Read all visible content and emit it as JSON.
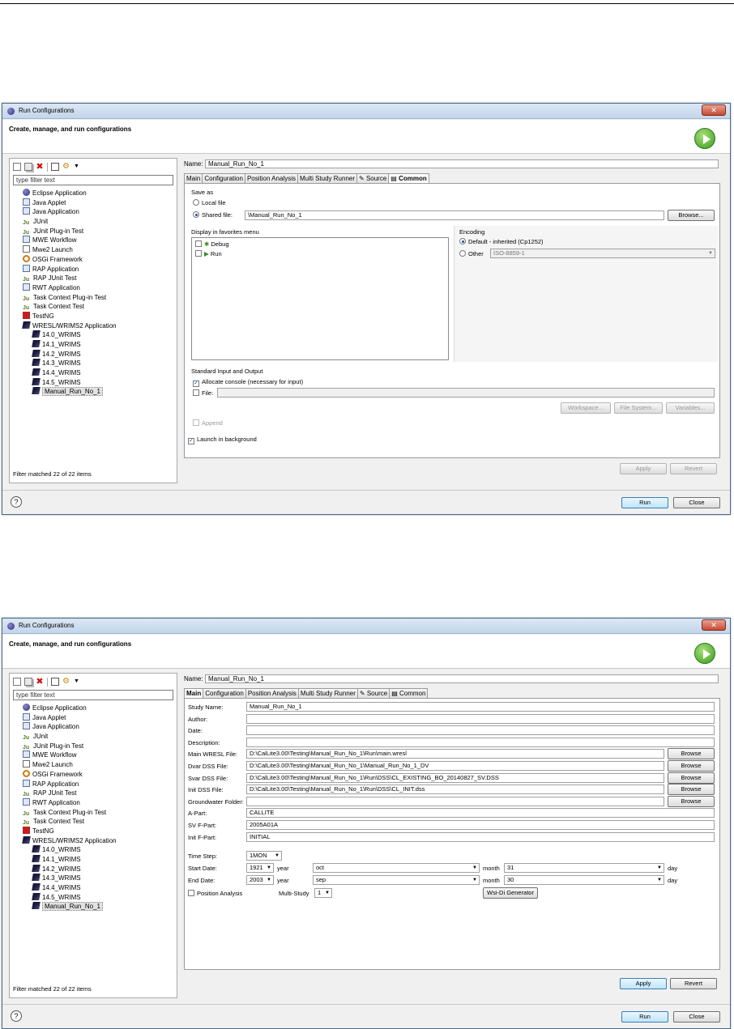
{
  "dialog1": {
    "title": "Run Configurations",
    "header": "Create, manage, and run configurations",
    "toolbar_icons": [
      "new-config-icon",
      "duplicate-icon",
      "delete-icon",
      "collapse-all-icon",
      "filter-icon",
      "dropdown-icon"
    ],
    "filter_placeholder": "type filter text",
    "tree": [
      {
        "label": "Eclipse Application",
        "icon": "circle",
        "level": 1
      },
      {
        "label": "Java Applet",
        "icon": "box",
        "level": 1
      },
      {
        "label": "Java Application",
        "icon": "box",
        "level": 1
      },
      {
        "label": "JUnit",
        "icon": "ju",
        "level": 1
      },
      {
        "label": "JUnit Plug-in Test",
        "icon": "ju",
        "level": 1
      },
      {
        "label": "MWE Workflow",
        "icon": "box",
        "level": 1
      },
      {
        "label": "Mwe2 Launch",
        "icon": "doc",
        "level": 1
      },
      {
        "label": "OSGi Framework",
        "icon": "gear",
        "level": 1
      },
      {
        "label": "RAP Application",
        "icon": "box",
        "level": 1
      },
      {
        "label": "RAP JUnit Test",
        "icon": "ju",
        "level": 1
      },
      {
        "label": "RWT Application",
        "icon": "box",
        "level": 1
      },
      {
        "label": "Task Context Plug-in Test",
        "icon": "ju",
        "level": 1
      },
      {
        "label": "Task Context Test",
        "icon": "ju",
        "level": 1
      },
      {
        "label": "TestNG",
        "icon": "ng",
        "level": 1
      },
      {
        "label": "WRESL/WRIMS2 Application",
        "icon": "w",
        "level": 1
      },
      {
        "label": "14.0_WRIMS",
        "icon": "w",
        "level": 2
      },
      {
        "label": "14.1_WRIMS",
        "icon": "w",
        "level": 2
      },
      {
        "label": "14.2_WRIMS",
        "icon": "w",
        "level": 2
      },
      {
        "label": "14.3_WRIMS",
        "icon": "w",
        "level": 2
      },
      {
        "label": "14.4_WRIMS",
        "icon": "w",
        "level": 2
      },
      {
        "label": "14.5_WRIMS",
        "icon": "w",
        "level": 2
      },
      {
        "label": "Manual_Run_No_1",
        "icon": "w",
        "level": 2,
        "selected": true
      }
    ],
    "filter_status": "Filter matched 22 of 22 items",
    "name_label": "Name:",
    "name_value": "Manual_Run_No_1",
    "tabs": [
      "Main",
      "Configuration",
      "Position Analysis",
      "Multi Study Runner",
      "Source",
      "Common"
    ],
    "active_tab": "Common",
    "save_as": {
      "title": "Save as",
      "local_file": "Local file",
      "shared_file": "Shared file:",
      "shared_value": "\\Manual_Run_No_1",
      "browse": "Browse..."
    },
    "favorites": {
      "title": "Display in favorites menu",
      "debug": "Debug",
      "run": "Run"
    },
    "encoding": {
      "title": "Encoding",
      "default": "Default - inherited (Cp1252)",
      "other": "Other",
      "other_value": "ISO-8859-1"
    },
    "std_io": {
      "title": "Standard Input and Output",
      "allocate": "Allocate console (necessary for input)",
      "file": "File:",
      "workspace": "Workspace...",
      "file_system": "File System...",
      "variables": "Variables...",
      "append": "Append"
    },
    "launch_bg": "Launch in background",
    "apply": "Apply",
    "revert": "Revert",
    "run": "Run",
    "close": "Close"
  },
  "dialog2": {
    "title": "Run Configurations",
    "header": "Create, manage, and run configurations",
    "filter_placeholder": "type filter text",
    "filter_status": "Filter matched 22 of 22 items",
    "name_label": "Name:",
    "name_value": "Manual_Run_No_1",
    "tabs": [
      "Main",
      "Configuration",
      "Position Analysis",
      "Multi Study Runner",
      "Source",
      "Common"
    ],
    "active_tab": "Main",
    "fields": [
      {
        "label": "Study Name:",
        "value": "Manual_Run_No_1",
        "browse": false
      },
      {
        "label": "Author:",
        "value": "",
        "browse": false
      },
      {
        "label": "Date:",
        "value": "",
        "browse": false
      },
      {
        "label": "Description:",
        "value": "",
        "browse": false
      },
      {
        "label": "Main WRESL File:",
        "value": "D:\\CalLite3.00\\Testing\\Manual_Run_No_1\\Run\\main.wresl",
        "browse": true
      },
      {
        "label": "Dvar DSS File:",
        "value": "D:\\CalLite3.00\\Testing\\Manual_Run_No_1\\Manual_Run_No_1_DV",
        "browse": true
      },
      {
        "label": "Svar DSS File:",
        "value": "D:\\CalLite3.00\\Testing\\Manual_Run_No_1\\Run\\DSS\\CL_EXISTING_BO_20140827_SV.DSS",
        "browse": true
      },
      {
        "label": "Init DSS File:",
        "value": "D:\\CalLite3.00\\Testing\\Manual_Run_No_1\\Run\\DSS\\CL_INIT.dss",
        "browse": true
      },
      {
        "label": "Groundwater Folder:",
        "value": "",
        "browse": true
      },
      {
        "label": "A-Part:",
        "value": "CALLITE",
        "browse": false
      },
      {
        "label": "SV F-Part:",
        "value": "2005A01A",
        "browse": false
      },
      {
        "label": "Init F-Part:",
        "value": "INITIAL",
        "browse": false
      }
    ],
    "browse": "Browse",
    "time_step_label": "Time Step:",
    "time_step": "1MON",
    "start_date_label": "Start Date:",
    "start_year": "1921",
    "start_month": "oct",
    "start_day": "31",
    "end_date_label": "End Date:",
    "end_year": "2003",
    "end_month": "sep",
    "end_day": "30",
    "year_label": "year",
    "month_label": "month",
    "day_label": "day",
    "position_analysis": "Position Analysis",
    "multi_study_label": "Multi-Study",
    "multi_study_value": "1",
    "wsi_button": "Wsi-Di Generator",
    "apply": "Apply",
    "revert": "Revert",
    "run": "Run",
    "close": "Close"
  }
}
